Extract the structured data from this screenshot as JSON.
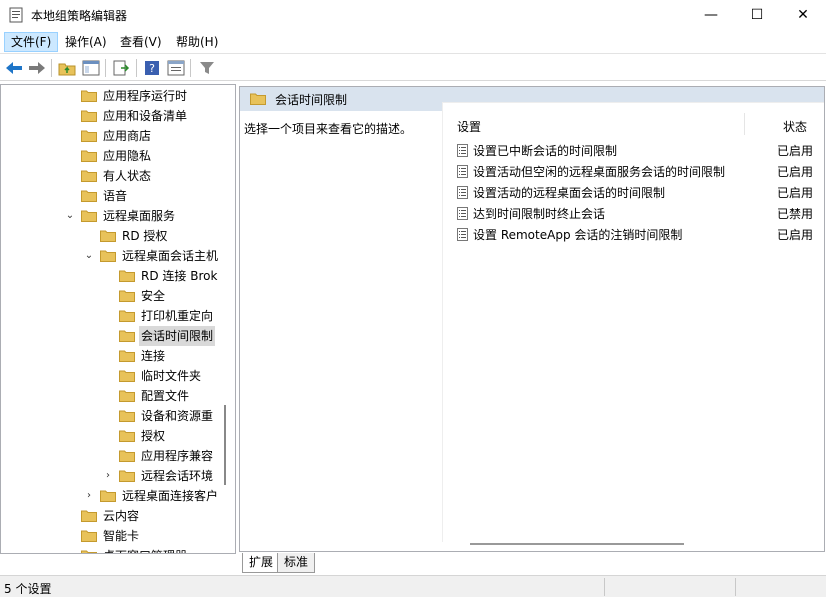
{
  "window": {
    "title": "本地组策略编辑器",
    "minimize": "—",
    "maximize": "☐",
    "close": "✕"
  },
  "menu": [
    {
      "label": "文件(F)"
    },
    {
      "label": "操作(A)"
    },
    {
      "label": "查看(V)"
    },
    {
      "label": "帮助(H)"
    }
  ],
  "toolbar": [
    "back-icon",
    "forward-icon",
    "up-folder-icon",
    "show-hide-tree-icon",
    "export-list-icon",
    "help-icon",
    "properties-icon",
    "filter-icon"
  ],
  "colors": {
    "folder": "#e8c25a",
    "header_bg": "#d9e3ee",
    "selected_bg": "#d9d9d9",
    "accent": "#1e75c8"
  },
  "tree": [
    {
      "label": "应用程序运行时",
      "expander": ""
    },
    {
      "label": "应用和设备清单",
      "expander": ""
    },
    {
      "label": "应用商店",
      "expander": ""
    },
    {
      "label": "应用隐私",
      "expander": ""
    },
    {
      "label": "有人状态",
      "expander": ""
    },
    {
      "label": "语音",
      "expander": ""
    },
    {
      "label": "远程桌面服务",
      "expander": "expanded"
    },
    {
      "label": "RD 授权",
      "expander": ""
    },
    {
      "label": "远程桌面会话主机",
      "expander": "expanded"
    },
    {
      "label": "RD 连接 Brok",
      "expander": ""
    },
    {
      "label": "安全",
      "expander": ""
    },
    {
      "label": "打印机重定向",
      "expander": ""
    },
    {
      "label": "会话时间限制",
      "expander": "",
      "selected": true
    },
    {
      "label": "连接",
      "expander": ""
    },
    {
      "label": "临时文件夹",
      "expander": ""
    },
    {
      "label": "配置文件",
      "expander": ""
    },
    {
      "label": "设备和资源重",
      "expander": ""
    },
    {
      "label": "授权",
      "expander": ""
    },
    {
      "label": "应用程序兼容",
      "expander": ""
    },
    {
      "label": "远程会话环境",
      "expander": "collapsed"
    },
    {
      "label": "远程桌面连接客户",
      "expander": "collapsed"
    },
    {
      "label": "云内容",
      "expander": ""
    },
    {
      "label": "智能卡",
      "expander": ""
    },
    {
      "label": "桌面窗口管理器",
      "expander": "collapsed"
    }
  ],
  "detail": {
    "header_title": "会话时间限制",
    "description": "选择一个项目来查看它的描述。",
    "columns": {
      "setting": "设置",
      "state": "状态"
    },
    "rows": [
      {
        "name": "设置已中断会话的时间限制",
        "state": "已启用"
      },
      {
        "name": "设置活动但空闲的远程桌面服务会话的时间限制",
        "state": "已启用"
      },
      {
        "name": "设置活动的远程桌面会话的时间限制",
        "state": "已启用"
      },
      {
        "name": "达到时间限制时终止会话",
        "state": "已禁用"
      },
      {
        "name": "设置 RemoteApp 会话的注销时间限制",
        "state": "已启用"
      }
    ]
  },
  "tabs": [
    {
      "label": "扩展"
    },
    {
      "label": "标准"
    }
  ],
  "status": {
    "text": "5 个设置"
  }
}
